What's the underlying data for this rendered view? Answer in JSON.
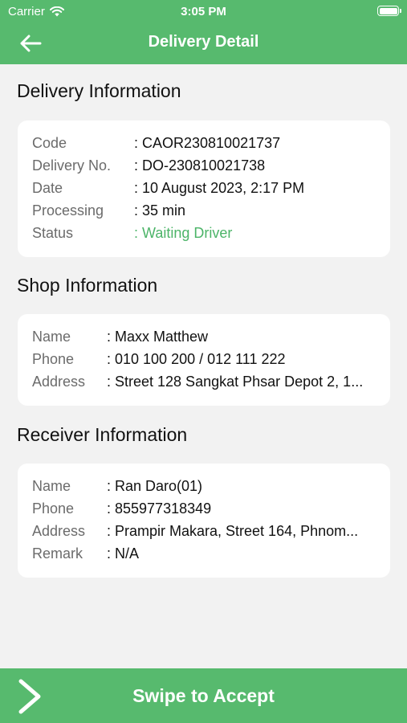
{
  "status_bar": {
    "carrier": "Carrier",
    "time": "3:05 PM"
  },
  "header": {
    "title": "Delivery Detail",
    "back_icon": "arrow-left-icon"
  },
  "delivery": {
    "section_title": "Delivery Information",
    "rows": [
      {
        "label": "Code",
        "value": ": CAOR230810021737"
      },
      {
        "label": "Delivery No.",
        "value": ": DO-230810021738"
      },
      {
        "label": "Date",
        "value": ": 10 August 2023, 2:17 PM"
      },
      {
        "label": "Processing",
        "value": ": 35 min"
      },
      {
        "label": "Status",
        "value": ": Waiting Driver"
      }
    ],
    "status_color": "#4cb468"
  },
  "shop": {
    "section_title": "Shop Information",
    "rows": [
      {
        "label": "Name",
        "value": ": Maxx Matthew"
      },
      {
        "label": "Phone",
        "value": ": 010 100 200 / 012 111 222"
      },
      {
        "label": "Address",
        "value": ": Street 128 Sangkat Phsar Depot 2, 1..."
      }
    ]
  },
  "receiver": {
    "section_title": "Receiver Information",
    "rows": [
      {
        "label": "Name",
        "value": ": Ran Daro(01)"
      },
      {
        "label": "Phone",
        "value": ": 855977318349"
      },
      {
        "label": "Address",
        "value": ": Prampir Makara, Street 164, Phnom..."
      },
      {
        "label": "Remark",
        "value": ": N/A"
      }
    ]
  },
  "footer": {
    "accept_label": "Swipe to Accept",
    "icon": "chevron-right-icon"
  },
  "colors": {
    "accent": "#57ba6e",
    "background": "#f2f2f2"
  }
}
